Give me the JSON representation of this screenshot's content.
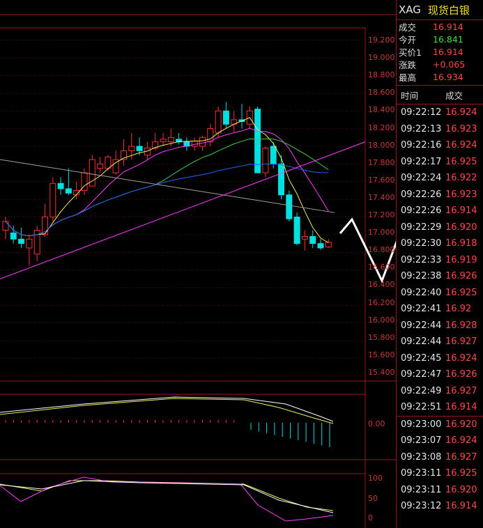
{
  "quote": {
    "symbol": "XAG",
    "name": "现货白银",
    "rows": [
      {
        "label": "成交",
        "value": "16.914",
        "color": "red"
      },
      {
        "label": "今开",
        "value": "16.841",
        "color": "green"
      },
      {
        "label": "买价1",
        "value": "16.914",
        "color": "red"
      },
      {
        "label": "涨跌",
        "value": "+0.065",
        "color": "red"
      },
      {
        "label": "最高",
        "value": "16.934",
        "color": "red"
      }
    ]
  },
  "ticks": {
    "header": {
      "time": "时间",
      "price": "成交"
    },
    "rows": [
      {
        "time": "09:22:12",
        "price": "16.924"
      },
      {
        "time": "09:22:13",
        "price": "16.923"
      },
      {
        "time": "09:22:16",
        "price": "16.924"
      },
      {
        "time": "09:22:17",
        "price": "16.925"
      },
      {
        "time": "09:22:24",
        "price": "16.922"
      },
      {
        "time": "09:22:26",
        "price": "16.923"
      },
      {
        "time": "09:22:26",
        "price": "16.914"
      },
      {
        "time": "09:22:29",
        "price": "16.920"
      },
      {
        "time": "09:22:30",
        "price": "16.918"
      },
      {
        "time": "09:22:33",
        "price": "16.919"
      },
      {
        "time": "09:22:38",
        "price": "16.926"
      },
      {
        "time": "09:22:40",
        "price": "16.925"
      },
      {
        "time": "09:22:41",
        "price": "16.92"
      },
      {
        "time": "09:22:44",
        "price": "16.928"
      },
      {
        "time": "09:22:44",
        "price": "16.927"
      },
      {
        "time": "09:22:45",
        "price": "16.924"
      },
      {
        "time": "09:22:47",
        "price": "16.926"
      },
      {
        "time": "09:22:49",
        "price": "16.927"
      },
      {
        "time": "09:22:51",
        "price": "16.914"
      },
      {
        "time": "09:23:00",
        "price": "16.920"
      },
      {
        "time": "09:23:07",
        "price": "16.924"
      },
      {
        "time": "09:23:08",
        "price": "16.927"
      },
      {
        "time": "09:23:11",
        "price": "16.925"
      },
      {
        "time": "09:23:11",
        "price": "16.920"
      },
      {
        "time": "09:23:12",
        "price": "16.914"
      }
    ]
  },
  "price_axis": [
    "19.200",
    "19.000",
    "18.800",
    "18.600",
    "18.400",
    "18.200",
    "18.000",
    "17.800",
    "17.600",
    "17.400",
    "17.200",
    "17.000",
    "16.800",
    "16.600",
    "16.400",
    "16.200",
    "16.000",
    "15.800",
    "15.600",
    "15.400"
  ],
  "macd_axis": [
    "0.00"
  ],
  "kdj_axis": [
    "100",
    "50",
    "0"
  ],
  "colors": {
    "up": "#ff3030",
    "down": "#00e0e0",
    "grid": "#9a1a1a"
  },
  "chart_data": {
    "type": "candlestick",
    "ylim": [
      15.4,
      19.3
    ],
    "candles": [
      {
        "o": 17.05,
        "h": 17.2,
        "l": 16.95,
        "c": 17.15
      },
      {
        "o": 17.02,
        "h": 17.1,
        "l": 16.9,
        "c": 16.95
      },
      {
        "o": 16.95,
        "h": 17.08,
        "l": 16.85,
        "c": 16.9
      },
      {
        "o": 16.85,
        "h": 17.0,
        "l": 16.65,
        "c": 16.95
      },
      {
        "o": 16.78,
        "h": 17.1,
        "l": 16.7,
        "c": 17.05
      },
      {
        "o": 17.0,
        "h": 17.35,
        "l": 16.98,
        "c": 17.2
      },
      {
        "o": 17.2,
        "h": 17.65,
        "l": 17.15,
        "c": 17.58
      },
      {
        "o": 17.58,
        "h": 17.65,
        "l": 17.45,
        "c": 17.52
      },
      {
        "o": 17.52,
        "h": 17.75,
        "l": 17.45,
        "c": 17.47
      },
      {
        "o": 17.45,
        "h": 17.6,
        "l": 17.4,
        "c": 17.5
      },
      {
        "o": 17.5,
        "h": 17.75,
        "l": 17.45,
        "c": 17.7
      },
      {
        "o": 17.55,
        "h": 17.9,
        "l": 17.55,
        "c": 17.85
      },
      {
        "o": 17.75,
        "h": 17.88,
        "l": 17.7,
        "c": 17.8
      },
      {
        "o": 17.75,
        "h": 17.9,
        "l": 17.72,
        "c": 17.88
      },
      {
        "o": 17.7,
        "h": 17.95,
        "l": 17.68,
        "c": 17.85
      },
      {
        "o": 17.85,
        "h": 18.08,
        "l": 17.78,
        "c": 17.95
      },
      {
        "o": 17.95,
        "h": 18.15,
        "l": 17.85,
        "c": 18.0
      },
      {
        "o": 18.0,
        "h": 18.1,
        "l": 17.9,
        "c": 17.95
      },
      {
        "o": 17.9,
        "h": 18.05,
        "l": 17.85,
        "c": 17.98
      },
      {
        "o": 17.98,
        "h": 18.15,
        "l": 17.95,
        "c": 18.05
      },
      {
        "o": 18.05,
        "h": 18.15,
        "l": 18.0,
        "c": 18.08
      },
      {
        "o": 18.05,
        "h": 18.2,
        "l": 18.0,
        "c": 18.1
      },
      {
        "o": 18.08,
        "h": 18.15,
        "l": 18.02,
        "c": 18.05
      },
      {
        "o": 18.05,
        "h": 18.1,
        "l": 17.95,
        "c": 18.0
      },
      {
        "o": 18.0,
        "h": 18.1,
        "l": 17.95,
        "c": 18.06
      },
      {
        "o": 18.0,
        "h": 18.12,
        "l": 17.95,
        "c": 18.1
      },
      {
        "o": 18.05,
        "h": 18.25,
        "l": 18.0,
        "c": 18.2
      },
      {
        "o": 18.15,
        "h": 18.45,
        "l": 18.1,
        "c": 18.4
      },
      {
        "o": 18.4,
        "h": 18.5,
        "l": 18.2,
        "c": 18.25
      },
      {
        "o": 18.25,
        "h": 18.4,
        "l": 18.15,
        "c": 18.3
      },
      {
        "o": 18.3,
        "h": 18.48,
        "l": 18.2,
        "c": 18.28
      },
      {
        "o": 18.25,
        "h": 18.45,
        "l": 18.2,
        "c": 18.4
      },
      {
        "o": 18.42,
        "h": 18.45,
        "l": 17.7,
        "c": 17.7
      },
      {
        "o": 17.7,
        "h": 18.0,
        "l": 17.65,
        "c": 17.98
      },
      {
        "o": 18.0,
        "h": 18.05,
        "l": 17.75,
        "c": 17.8
      },
      {
        "o": 17.8,
        "h": 17.9,
        "l": 17.4,
        "c": 17.45
      },
      {
        "o": 17.45,
        "h": 17.5,
        "l": 17.15,
        "c": 17.18
      },
      {
        "o": 17.2,
        "h": 17.25,
        "l": 16.88,
        "c": 16.9
      },
      {
        "o": 16.95,
        "h": 17.05,
        "l": 16.82,
        "c": 16.98
      },
      {
        "o": 16.98,
        "h": 17.05,
        "l": 16.85,
        "c": 16.9
      },
      {
        "o": 16.9,
        "h": 16.95,
        "l": 16.83,
        "c": 16.85
      },
      {
        "o": 16.86,
        "h": 16.95,
        "l": 16.85,
        "c": 16.914
      }
    ]
  }
}
